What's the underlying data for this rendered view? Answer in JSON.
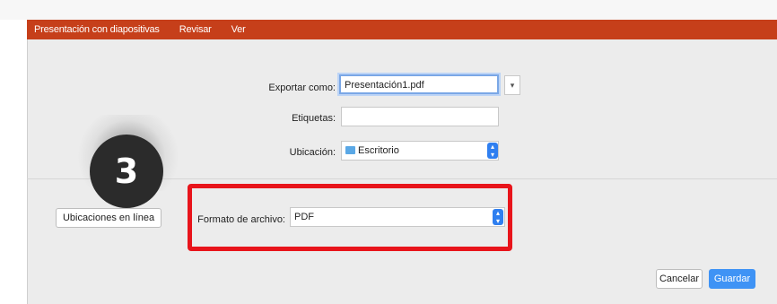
{
  "menubar": {
    "items": [
      "Presentación con diapositivas",
      "Revisar",
      "Ver"
    ]
  },
  "form": {
    "export_as_label": "Exportar como:",
    "export_as_value": "Presentación1.pdf",
    "tags_label": "Etiquetas:",
    "tags_value": "",
    "location_label": "Ubicación:",
    "location_value": "Escritorio",
    "file_format_label": "Formato de archivo:",
    "file_format_value": "PDF"
  },
  "buttons": {
    "online_locations": "Ubicaciones en línea",
    "cancel": "Cancelar",
    "save": "Guardar"
  },
  "annotation": {
    "step_number": "3",
    "highlight_color": "#e8141b"
  },
  "colors": {
    "menubar": "#c63f1a",
    "primary_button": "#3f93f5"
  }
}
